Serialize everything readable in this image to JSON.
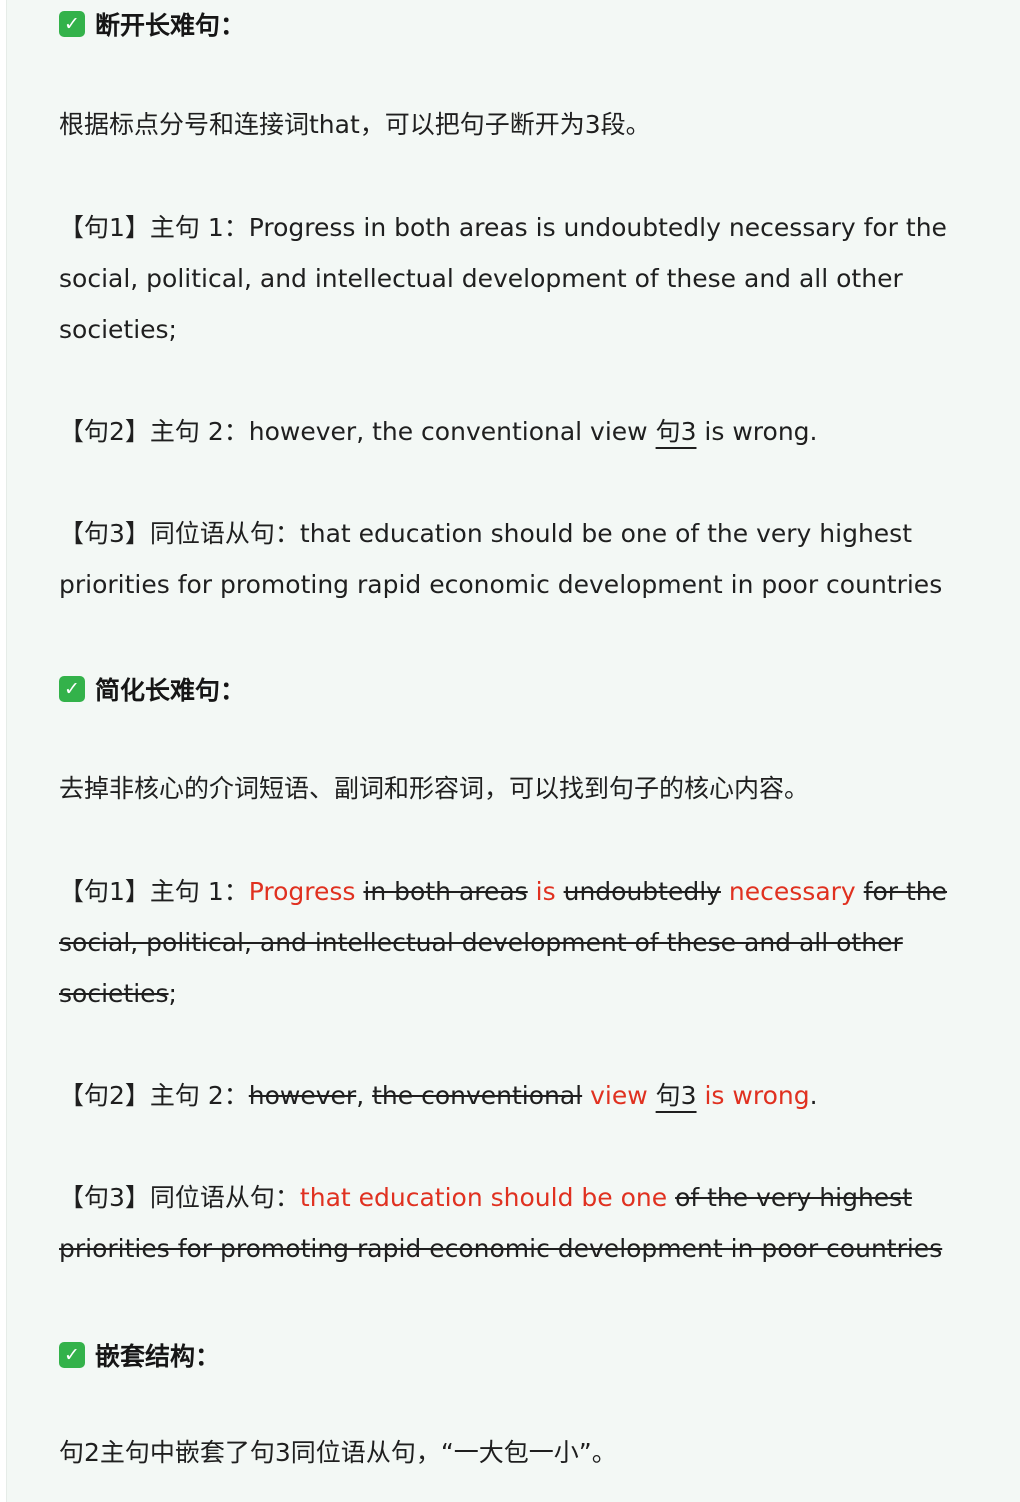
{
  "section1": {
    "check_glyph": "✓",
    "heading": "断开长难句：",
    "intro": "根据标点分号和连接词that，可以把句子断开为3段。",
    "s1": {
      "label": "【句1】主句 1：",
      "text": "Progress in both areas is undoubtedly necessary for the social, political, and intellectual development of these and all other societies;"
    },
    "s2": {
      "label": "【句2】主句 2：",
      "before": "however, the conventional view ",
      "ref": "句3",
      "after": " is wrong."
    },
    "s3": {
      "label": "【句3】同位语从句：",
      "text": "that education should be one of the very highest priorities for promoting rapid economic development in poor countries"
    }
  },
  "section2": {
    "check_glyph": "✓",
    "heading": "简化长难句：",
    "intro": "去掉非核心的介词短语、副词和形容词，可以找到句子的核心内容。",
    "s1": {
      "label": "【句1】主句 1：",
      "p1": "Progress",
      "p2": "in both areas",
      "p3": "is",
      "p4": "undoubtedly",
      "p5": "necessary",
      "p6": "for the social, political, and intellectual development of these and all other societies",
      "p7": ";"
    },
    "s2": {
      "label": "【句2】主句 2：",
      "p1": "however",
      "p2": ",",
      "p3": "the conventional",
      "p4": "view",
      "ref": "句3",
      "p5": "is wrong",
      "p6": "."
    },
    "s3": {
      "label": "【句3】同位语从句：",
      "p1": "that education should be one",
      "p2": "of the very highest priorities for promoting rapid economic development in poor countries"
    }
  },
  "section3": {
    "check_glyph": "✓",
    "heading": "嵌套结构：",
    "text": "句2主句中嵌套了句3同位语从句，“一大包一小”。"
  },
  "colors": {
    "background": "#f3f8f5",
    "text": "#1f1f1f",
    "highlight_red": "#e03120",
    "check_green": "#33b24a"
  }
}
